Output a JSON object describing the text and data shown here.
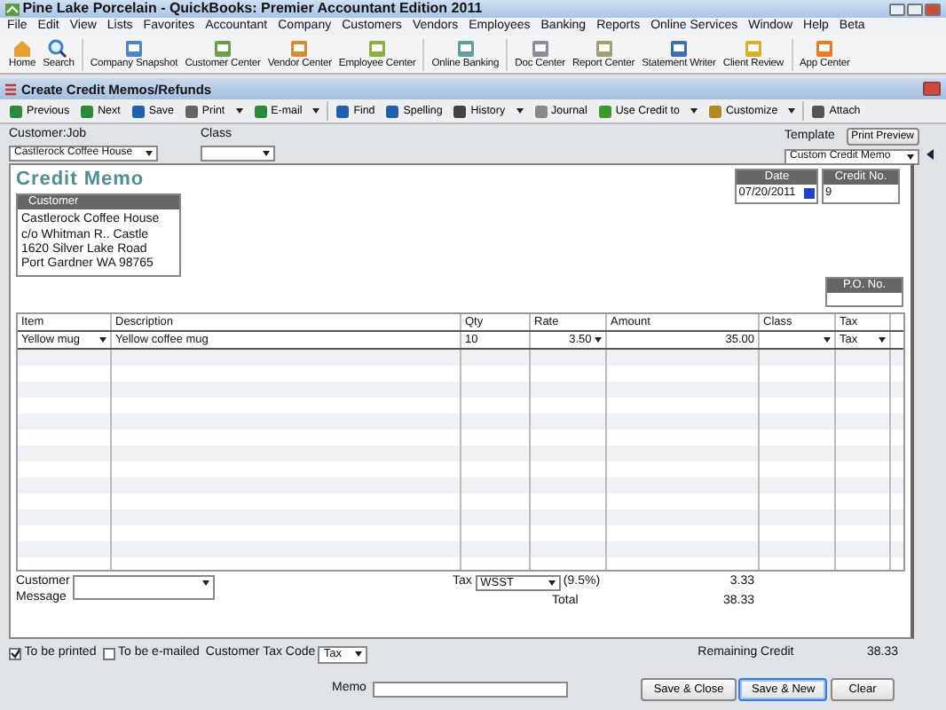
{
  "window": {
    "title": "Pine Lake Porcelain  - QuickBooks: Premier Accountant Edition 2011"
  },
  "menu": [
    "File",
    "Edit",
    "View",
    "Lists",
    "Favorites",
    "Accountant",
    "Company",
    "Customers",
    "Vendors",
    "Employees",
    "Banking",
    "Reports",
    "Online Services",
    "Window",
    "Help",
    "Beta"
  ],
  "icon_bar": [
    {
      "label": "Home"
    },
    {
      "label": "Search"
    },
    {
      "label": "Company Snapshot"
    },
    {
      "label": "Customer Center"
    },
    {
      "label": "Vendor Center"
    },
    {
      "label": "Employee Center"
    },
    {
      "label": "Online Banking"
    },
    {
      "label": "Doc Center"
    },
    {
      "label": "Report Center"
    },
    {
      "label": "Statement Writer"
    },
    {
      "label": "Client Review"
    },
    {
      "label": "App Center"
    }
  ],
  "form_window": {
    "title": "Create Credit Memos/Refunds"
  },
  "toolbar": [
    {
      "label": "Previous",
      "dropdown": false
    },
    {
      "label": "Next",
      "dropdown": false
    },
    {
      "label": "Save",
      "dropdown": false
    },
    {
      "label": "Print",
      "dropdown": true
    },
    {
      "label": "E-mail",
      "dropdown": true
    },
    {
      "label": "Find",
      "dropdown": false
    },
    {
      "label": "Spelling",
      "dropdown": false
    },
    {
      "label": "History",
      "dropdown": true
    },
    {
      "label": "Journal",
      "dropdown": false
    },
    {
      "label": "Use Credit to",
      "dropdown": true
    },
    {
      "label": "Customize",
      "dropdown": true
    },
    {
      "label": "Attach",
      "dropdown": false
    }
  ],
  "header": {
    "customer_job_label": "Customer:Job",
    "customer_job": "Castlerock Coffee House",
    "class_label": "Class",
    "template_label": "Template",
    "print_preview": "Print Preview",
    "template": "Custom Credit Memo"
  },
  "form": {
    "heading": "Credit Memo",
    "date_label": "Date",
    "date": "07/20/2011",
    "credit_no_label": "Credit No.",
    "credit_no": "9",
    "customer_label": "Customer",
    "address": [
      "Castlerock Coffee House",
      "c/o Whitman R.. Castle",
      "1620 Silver Lake Road",
      "Port Gardner WA 98765"
    ],
    "po_label": "P.O. No."
  },
  "table": {
    "columns": [
      "Item",
      "Description",
      "Qty",
      "Rate",
      "Amount",
      "Class",
      "Tax"
    ],
    "rows": [
      {
        "item": "Yellow mug",
        "description": "Yellow coffee mug",
        "qty": "10",
        "rate": "3.50",
        "amount": "35.00",
        "tax": "Tax"
      }
    ]
  },
  "totals": {
    "message_label": "Customer Message",
    "tax_label": "Tax",
    "tax_code": "WSST",
    "tax_rate": "(9.5%)",
    "tax_amount": "3.33",
    "total_label": "Total",
    "total": "38.33"
  },
  "options": {
    "to_be_printed": {
      "label": "To be printed",
      "checked": true
    },
    "to_be_emailed": {
      "label": "To be e-mailed",
      "checked": false
    },
    "tax_code_label": "Customer Tax Code",
    "tax_code": "Tax",
    "remaining_label": "Remaining Credit",
    "remaining": "38.33"
  },
  "memo_label": "Memo",
  "buttons": [
    {
      "label": "Save & Close",
      "selected": false
    },
    {
      "label": "Save & New",
      "selected": true
    },
    {
      "label": "Clear",
      "selected": false
    }
  ]
}
